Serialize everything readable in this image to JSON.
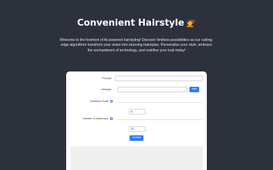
{
  "header": {
    "title": "Convenient Hairstyle",
    "title_emoji": "💇",
    "subtitle": "Welcome to the forefront of AI-powered hairstyling! Discover limitless possibilities as our cutting-edge algorithms transform your vision into stunning hairstyles. Personalize your style, embrace the enchantment of technology, and redefine your look today!"
  },
  "form": {
    "prompt": {
      "required_mark": "*",
      "label": "Prompt :",
      "value": ""
    },
    "hairstyle": {
      "label": "Hairstyle :",
      "value": "",
      "add_label": "Add"
    },
    "guidance": {
      "label": "Guidance Scale",
      "help": "?",
      "value": "8"
    },
    "inferences": {
      "label": "Number of Inferences",
      "help": "?",
      "value": "20"
    },
    "submit_label": "Submit"
  },
  "icons": {
    "select": "chevron-down-icon",
    "help": "help-circle-icon"
  },
  "colors": {
    "background": "#2c313c",
    "accent": "#2d7ff9",
    "card": "#ffffff"
  }
}
